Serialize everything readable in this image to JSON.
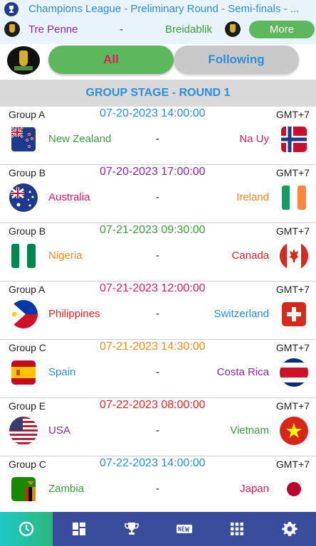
{
  "banner": {
    "title": "Champions League - Preliminary Round - Semi-finals - ...",
    "home_team": "Tre Penne",
    "separator": "-",
    "away_team": "Breidablik",
    "more_label": "More"
  },
  "filter": {
    "tab_all": "All",
    "tab_following": "Following"
  },
  "stage": {
    "title": "GROUP STAGE - ROUND 1"
  },
  "matches": [
    {
      "group": "Group A",
      "datetime": "07-20-2023 14:00:00",
      "datetime_color": "#2a8fdc",
      "tz": "GMT+7",
      "home": "New Zealand",
      "home_color": "#39a03c",
      "away": "Na Uy",
      "away_color": "#e0205a",
      "vs": "-",
      "home_flag": "new-zealand-flag",
      "away_flag": "norway-flag"
    },
    {
      "group": "Group B",
      "datetime": "07-20-2023 17:00:00",
      "datetime_color": "#8a2a9c",
      "tz": "GMT+7",
      "home": "Australia",
      "home_color": "#e0205a",
      "away": "Ireland",
      "away_color": "#f08c2a",
      "vs": "-",
      "home_flag": "australia-flag",
      "away_flag": "ireland-flag"
    },
    {
      "group": "Group B",
      "datetime": "07-21-2023 09:30:00",
      "datetime_color": "#39a03c",
      "tz": "GMT+7",
      "home": "Nigeria",
      "home_color": "#f08c2a",
      "away": "Canada",
      "away_color": "#e02a2a",
      "vs": "-",
      "home_flag": "nigeria-flag",
      "away_flag": "canada-flag"
    },
    {
      "group": "Group A",
      "datetime": "07-21-2023 12:00:00",
      "datetime_color": "#e0205a",
      "tz": "GMT+7",
      "home": "Philippines",
      "home_color": "#e02a2a",
      "away": "Switzerland",
      "away_color": "#2a8fdc",
      "vs": "-",
      "home_flag": "philippines-flag",
      "away_flag": "switzerland-flag"
    },
    {
      "group": "Group C",
      "datetime": "07-21-2023 14:30:00",
      "datetime_color": "#f08c2a",
      "tz": "GMT+7",
      "home": "Spain",
      "home_color": "#2a8fdc",
      "away": "Costa Rica",
      "away_color": "#8a2a9c",
      "vs": "-",
      "home_flag": "spain-flag",
      "away_flag": "costa-rica-flag"
    },
    {
      "group": "Group E",
      "datetime": "07-22-2023 08:00:00",
      "datetime_color": "#e02a2a",
      "tz": "GMT+7",
      "home": "USA",
      "home_color": "#8a2a9c",
      "away": "Vietnam",
      "away_color": "#39a03c",
      "vs": "-",
      "home_flag": "usa-flag",
      "away_flag": "vietnam-flag"
    },
    {
      "group": "Group C",
      "datetime": "07-22-2023 14:00:00",
      "datetime_color": "#2a8fdc",
      "tz": "GMT+7",
      "home": "Zambia",
      "home_color": "#39a03c",
      "away": "Japan",
      "away_color": "#e0205a",
      "vs": "-",
      "home_flag": "zambia-flag",
      "away_flag": "japan-flag"
    }
  ],
  "nav": [
    {
      "icon": "clock-icon",
      "active": true
    },
    {
      "icon": "dashboard-icon",
      "active": false
    },
    {
      "icon": "trophy-icon",
      "active": false
    },
    {
      "icon": "news-icon",
      "active": false
    },
    {
      "icon": "grid-icon",
      "active": false
    },
    {
      "icon": "gear-icon",
      "active": false
    }
  ]
}
